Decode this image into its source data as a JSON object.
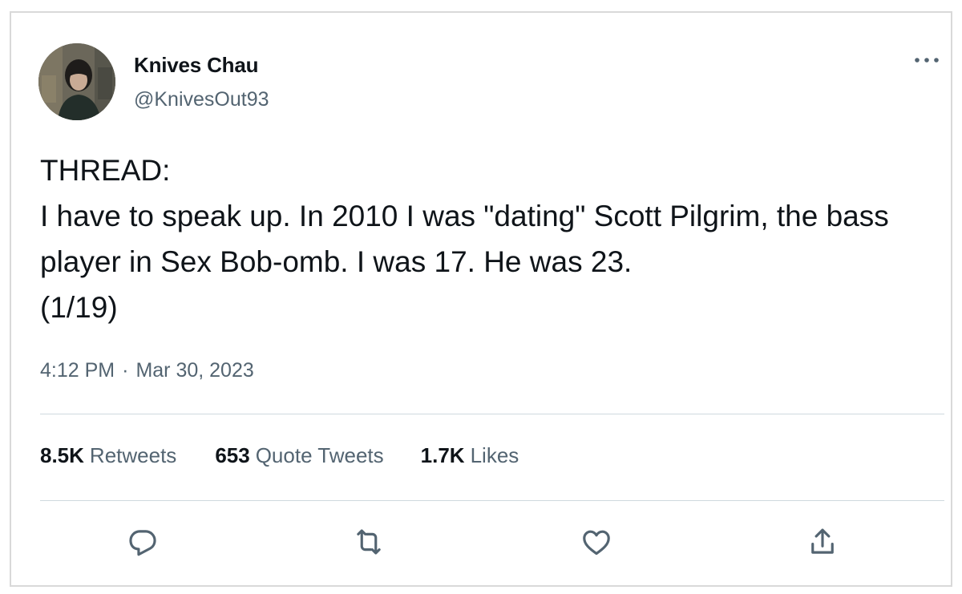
{
  "tweet": {
    "author": {
      "display_name": "Knives Chau",
      "handle": "@KnivesOut93",
      "avatar_icon": "profile-photo"
    },
    "text": "THREAD:\nI have to speak up. In 2010 I was \"dating\" Scott Pilgrim, the bass player in Sex Bob-omb. I was 17. He was 23.\n(1/19)",
    "time": "4:12 PM",
    "separator": "·",
    "date": "Mar 30, 2023",
    "stats": {
      "retweets": {
        "count": "8.5K",
        "label": "Retweets"
      },
      "quote_tweets": {
        "count": "653",
        "label": "Quote Tweets"
      },
      "likes": {
        "count": "1.7K",
        "label": "Likes"
      }
    },
    "actions": [
      {
        "name": "reply",
        "icon": "reply-icon"
      },
      {
        "name": "retweet",
        "icon": "retweet-icon"
      },
      {
        "name": "like",
        "icon": "heart-icon"
      },
      {
        "name": "share",
        "icon": "share-icon"
      }
    ],
    "more_icon": "more-dots-icon"
  },
  "colors": {
    "primary_text": "#0f1419",
    "secondary_text": "#536471",
    "divider": "#cfd9de",
    "frame_border": "#d9d9d9"
  }
}
